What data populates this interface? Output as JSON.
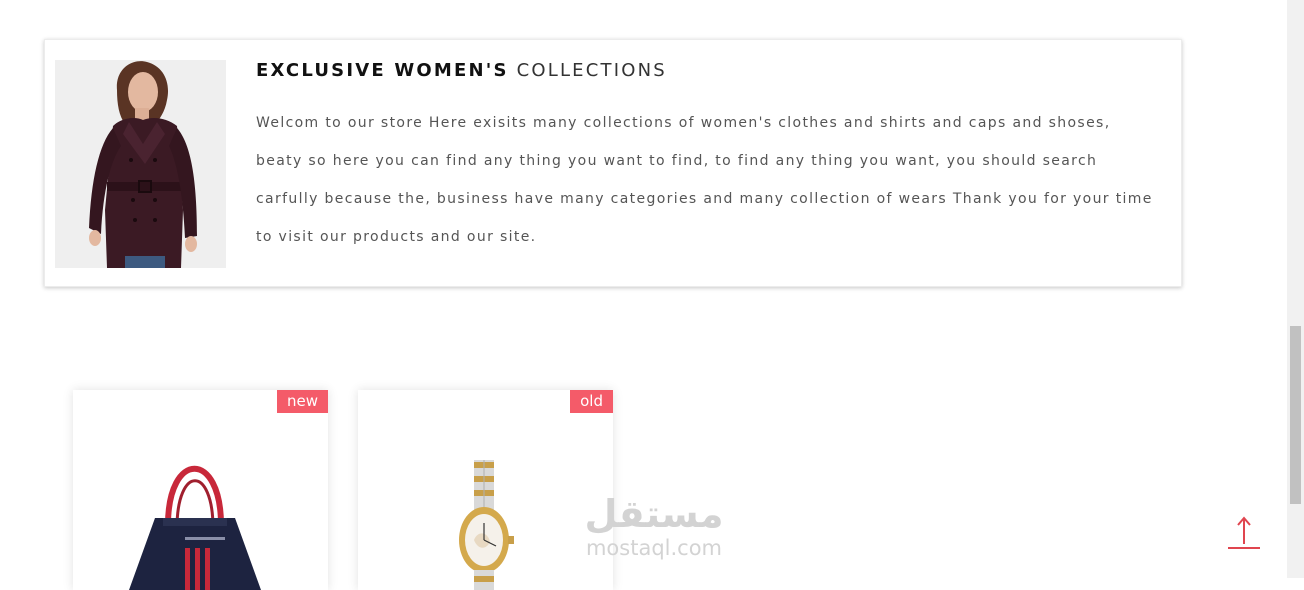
{
  "intro": {
    "title_bold": "EXCLUSIVE WOMEN'S",
    "title_light": "COLLECTIONS",
    "description": "Welcom to our store Here exisits many collections of women's clothes and shirts and caps and shoses, beaty so here you can find any thing you want to find, to find any thing you want, you should search carfully because the, business have many categories and many collection of wears Thank you for your time to visit our products and our site.",
    "photo_icon": "woman-coat-photo"
  },
  "products": [
    {
      "badge": "new",
      "image_icon": "handbag-image"
    },
    {
      "badge": "old",
      "image_icon": "wristwatch-image"
    }
  ],
  "watermark": {
    "arabic": "مستقل",
    "latin": "mostaql.com"
  },
  "scroll_top_icon": "arrow-up-icon",
  "colors": {
    "badge": "#f45b69",
    "scroll_top": "#e0454f"
  }
}
